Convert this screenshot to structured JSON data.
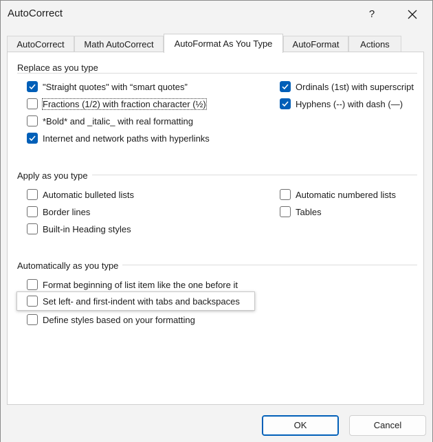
{
  "window": {
    "title": "AutoCorrect",
    "help_label": "?"
  },
  "tabs": [
    {
      "label": "AutoCorrect",
      "active": false
    },
    {
      "label": "Math AutoCorrect",
      "active": false
    },
    {
      "label": "AutoFormat As You Type",
      "active": true
    },
    {
      "label": "AutoFormat",
      "active": false
    },
    {
      "label": "Actions",
      "active": false
    }
  ],
  "groups": {
    "replace": {
      "title": "Replace as you type",
      "items": [
        {
          "label": "\"Straight quotes\" with “smart quotes”",
          "checked": true
        },
        {
          "label": "Fractions (1/2) with fraction character (½)",
          "checked": false
        },
        {
          "label": "*Bold* and _italic_ with real formatting",
          "checked": false
        },
        {
          "label": "Internet and network paths with hyperlinks",
          "checked": true
        },
        {
          "label": "Ordinals (1st) with superscript",
          "checked": true
        },
        {
          "label": "Hyphens (--) with dash (—)",
          "checked": true
        }
      ]
    },
    "apply": {
      "title": "Apply as you type",
      "items": [
        {
          "label": "Automatic bulleted lists",
          "checked": false
        },
        {
          "label": "Border lines",
          "checked": false
        },
        {
          "label": "Built-in Heading styles",
          "checked": false
        },
        {
          "label": "Automatic numbered lists",
          "checked": false
        },
        {
          "label": "Tables",
          "checked": false
        }
      ]
    },
    "auto": {
      "title": "Automatically as you type",
      "items": [
        {
          "label": "Format beginning of list item like the one before it",
          "checked": false
        },
        {
          "label": "Set left- and first-indent with tabs and backspaces",
          "checked": false
        },
        {
          "label": "Define styles based on your formatting",
          "checked": false
        }
      ]
    }
  },
  "buttons": {
    "ok": "OK",
    "cancel": "Cancel"
  },
  "colors": {
    "accent": "#005fb8"
  }
}
